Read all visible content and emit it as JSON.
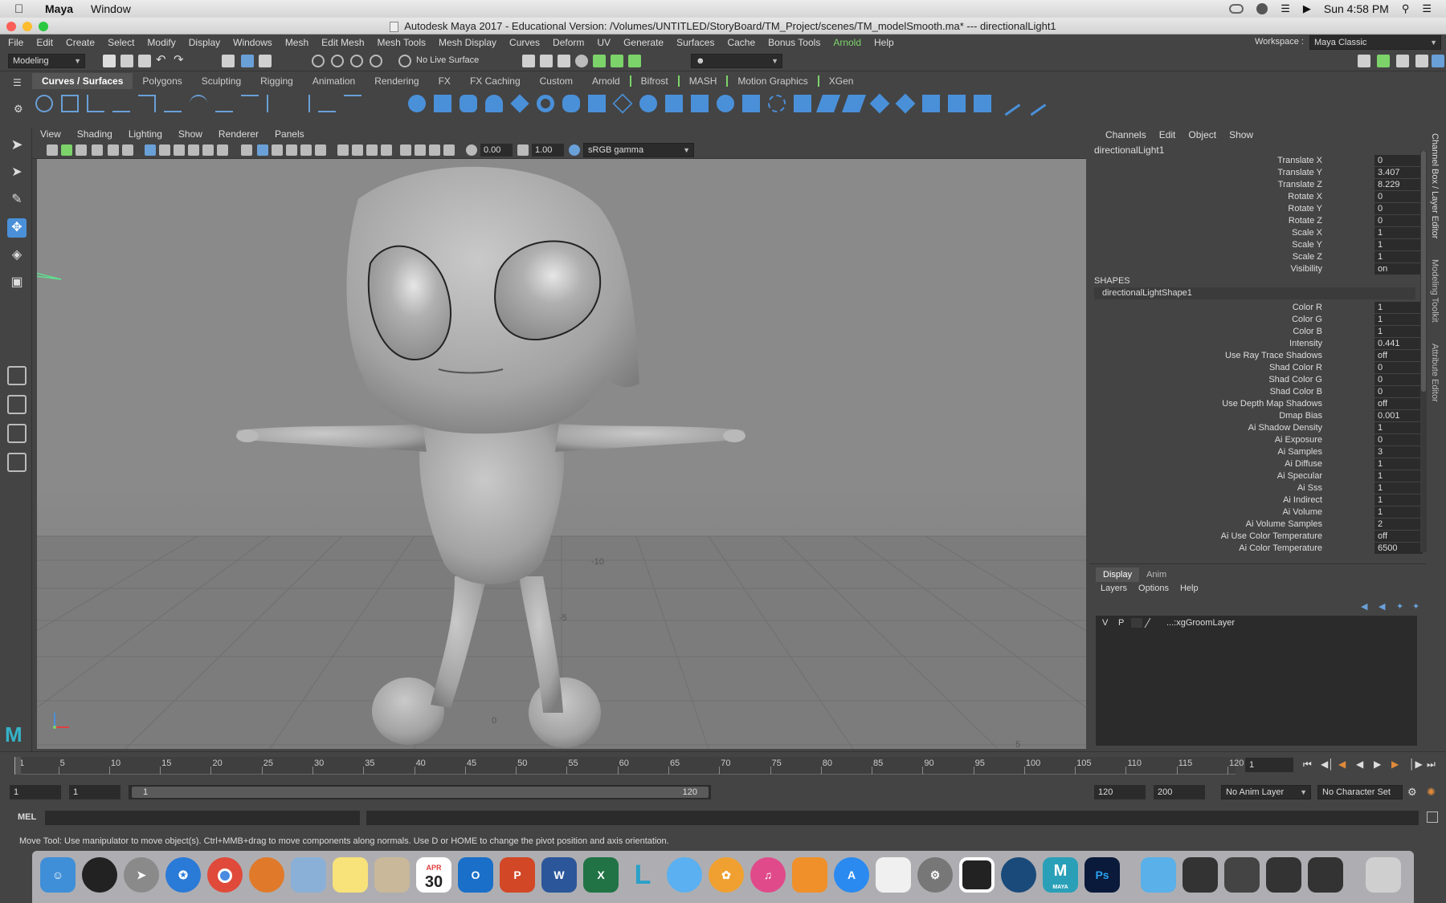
{
  "mac_menubar": {
    "app": "Maya",
    "items": [
      "Window"
    ],
    "clock": "Sun 4:58 PM"
  },
  "window": {
    "title": "Autodesk Maya 2017 - Educational Version: /Volumes/UNTITLED/StoryBoard/TM_Project/scenes/TM_modelSmooth.ma*  ---  directionalLight1"
  },
  "main_menu": {
    "items": [
      "File",
      "Edit",
      "Create",
      "Select",
      "Modify",
      "Display",
      "Windows",
      "Mesh",
      "Edit Mesh",
      "Mesh Tools",
      "Mesh Display",
      "Curves",
      "Deform",
      "UV",
      "Generate",
      "Surfaces",
      "Cache",
      "Bonus Tools",
      "Arnold",
      "Help"
    ],
    "workspace_label": "Workspace :",
    "workspace_value": "Maya Classic"
  },
  "status_line": {
    "menu_set": "Modeling",
    "live_surface": "No Live Surface"
  },
  "shelf": {
    "tabs": [
      "Curves / Surfaces",
      "Polygons",
      "Sculpting",
      "Rigging",
      "Animation",
      "Rendering",
      "FX",
      "FX Caching",
      "Custom",
      "Arnold",
      "Bifrost",
      "MASH",
      "Motion Graphics",
      "XGen"
    ],
    "active_tab": "Curves / Surfaces"
  },
  "viewport": {
    "menu": [
      "View",
      "Shading",
      "Lighting",
      "Show",
      "Renderer",
      "Panels"
    ],
    "exposure": "0.00",
    "gamma": "1.00",
    "color_space": "sRGB gamma",
    "grid_labels": [
      "-10",
      "-5",
      "0",
      "5"
    ]
  },
  "channel_box": {
    "menu": [
      "Channels",
      "Edit",
      "Object",
      "Show"
    ],
    "node": "directionalLight1",
    "transform_attrs": [
      {
        "label": "Translate X",
        "value": "0"
      },
      {
        "label": "Translate Y",
        "value": "3.407"
      },
      {
        "label": "Translate Z",
        "value": "8.229"
      },
      {
        "label": "Rotate X",
        "value": "0"
      },
      {
        "label": "Rotate Y",
        "value": "0"
      },
      {
        "label": "Rotate Z",
        "value": "0"
      },
      {
        "label": "Scale X",
        "value": "1"
      },
      {
        "label": "Scale Y",
        "value": "1"
      },
      {
        "label": "Scale Z",
        "value": "1"
      },
      {
        "label": "Visibility",
        "value": "on"
      }
    ],
    "shapes_header": "SHAPES",
    "shape_node": "directionalLightShape1",
    "shape_attrs": [
      {
        "label": "Color R",
        "value": "1"
      },
      {
        "label": "Color G",
        "value": "1"
      },
      {
        "label": "Color B",
        "value": "1"
      },
      {
        "label": "Intensity",
        "value": "0.441"
      },
      {
        "label": "Use Ray Trace Shadows",
        "value": "off"
      },
      {
        "label": "Shad Color R",
        "value": "0"
      },
      {
        "label": "Shad Color G",
        "value": "0"
      },
      {
        "label": "Shad Color B",
        "value": "0"
      },
      {
        "label": "Use Depth Map Shadows",
        "value": "off"
      },
      {
        "label": "Dmap Bias",
        "value": "0.001"
      },
      {
        "label": "Ai Shadow Density",
        "value": "1"
      },
      {
        "label": "Ai Exposure",
        "value": "0"
      },
      {
        "label": "Ai Samples",
        "value": "3"
      },
      {
        "label": "Ai Diffuse",
        "value": "1"
      },
      {
        "label": "Ai Specular",
        "value": "1"
      },
      {
        "label": "Ai Sss",
        "value": "1"
      },
      {
        "label": "Ai Indirect",
        "value": "1"
      },
      {
        "label": "Ai Volume",
        "value": "1"
      },
      {
        "label": "Ai Volume Samples",
        "value": "2"
      },
      {
        "label": "Ai Use Color Temperature",
        "value": "off"
      },
      {
        "label": "Ai Color Temperature",
        "value": "6500"
      }
    ]
  },
  "side_tabs": [
    "Channel Box / Layer Editor",
    "Modeling Toolkit",
    "Attribute Editor"
  ],
  "layer_editor": {
    "tabs": [
      "Display",
      "Anim"
    ],
    "active_tab": "Display",
    "menu": [
      "Layers",
      "Options",
      "Help"
    ],
    "layer": {
      "v": "V",
      "p": "P",
      "name": "...:xgGroomLayer"
    }
  },
  "time_slider": {
    "ticks": [
      "1",
      "5",
      "10",
      "15",
      "20",
      "25",
      "30",
      "35",
      "40",
      "45",
      "50",
      "55",
      "60",
      "65",
      "70",
      "75",
      "80",
      "85",
      "90",
      "95",
      "100",
      "105",
      "110",
      "115",
      "120"
    ],
    "current_frame": "1"
  },
  "range_slider": {
    "start": "1",
    "playback_start": "1",
    "range_start_label": "1",
    "range_end_label": "120",
    "playback_end": "120",
    "end": "200",
    "anim_layer": "No Anim Layer",
    "character_set": "No Character Set"
  },
  "command_line": {
    "label": "MEL"
  },
  "help_line": {
    "text": "Move Tool: Use manipulator to move object(s). Ctrl+MMB+drag to move components along normals. Use D or HOME to change the pivot position and axis orientation."
  },
  "dock": {
    "calendar_month": "APR",
    "calendar_day": "30",
    "apps": [
      "finder-icon",
      "siri-icon",
      "launchpad-icon",
      "safari-icon",
      "chrome-icon",
      "firefox-icon",
      "preview-icon",
      "notes-icon",
      "contacts-icon",
      "calendar-icon",
      "outlook-icon",
      "powerpoint-icon",
      "word-icon",
      "excel-icon",
      "lynda-icon",
      "messages-icon",
      "photos-icon",
      "itunes-icon",
      "ibooks-icon",
      "appstore-icon",
      "pinwheel-icon",
      "system-preferences-icon",
      "box-icon",
      "sourcetree-icon",
      "maya-icon",
      "photoshop-icon",
      "folder-icon",
      "window-thumb-icon",
      "trash-icon"
    ],
    "maya_label": "MAYA",
    "photoshop_label": "Ps"
  },
  "colors": {
    "ui_bg": "#444444",
    "field_bg": "#2b2b2b",
    "viewport_bg": "#8a8a8a",
    "arnold_green": "#7cd36a",
    "accent_blue": "#4a90d9"
  }
}
